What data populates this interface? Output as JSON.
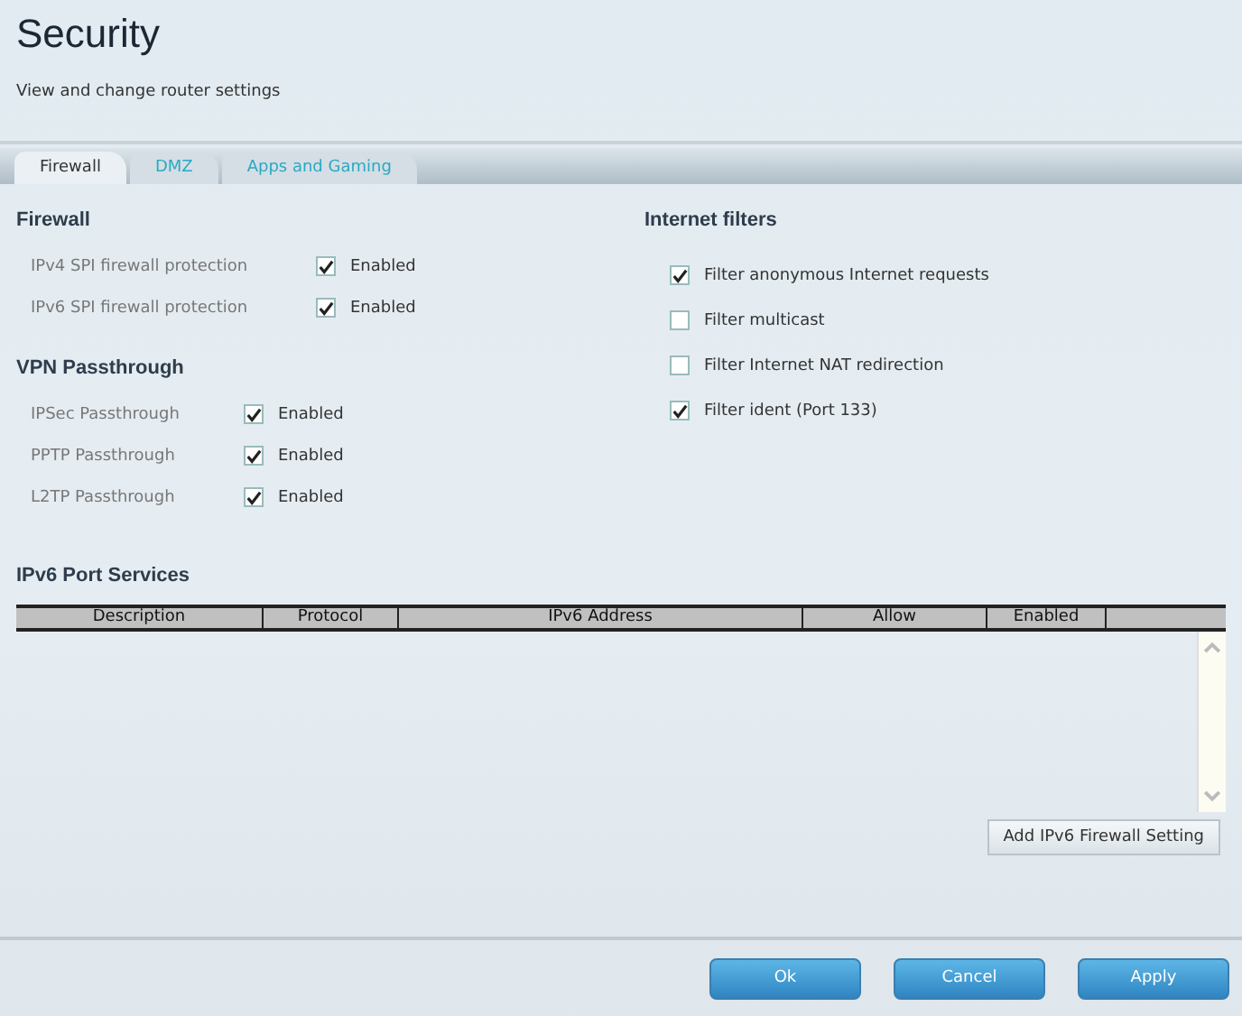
{
  "header": {
    "title": "Security",
    "subtitle": "View and change router settings"
  },
  "tabs": [
    {
      "label": "Firewall",
      "selected": true
    },
    {
      "label": "DMZ",
      "selected": false
    },
    {
      "label": "Apps and Gaming",
      "selected": false
    }
  ],
  "firewall": {
    "heading": "Firewall",
    "items": [
      {
        "label": "IPv4 SPI firewall protection",
        "checked": true,
        "text": "Enabled"
      },
      {
        "label": "IPv6 SPI firewall protection",
        "checked": true,
        "text": "Enabled"
      }
    ]
  },
  "vpn": {
    "heading": "VPN Passthrough",
    "items": [
      {
        "label": "IPSec Passthrough",
        "checked": true,
        "text": "Enabled"
      },
      {
        "label": "PPTP Passthrough",
        "checked": true,
        "text": "Enabled"
      },
      {
        "label": "L2TP Passthrough",
        "checked": true,
        "text": "Enabled"
      }
    ]
  },
  "internet_filters": {
    "heading": "Internet filters",
    "items": [
      {
        "label": "Filter anonymous Internet requests",
        "checked": true
      },
      {
        "label": "Filter multicast",
        "checked": false
      },
      {
        "label": "Filter Internet NAT redirection",
        "checked": false
      },
      {
        "label": "Filter ident (Port 133)",
        "checked": true
      }
    ]
  },
  "port_services": {
    "heading": "IPv6 Port Services",
    "columns": [
      "Description",
      "Protocol",
      "IPv6 Address",
      "Allow",
      "Enabled"
    ],
    "add_button": "Add IPv6 Firewall Setting"
  },
  "buttons": [
    "Ok",
    "Cancel",
    "Apply"
  ]
}
